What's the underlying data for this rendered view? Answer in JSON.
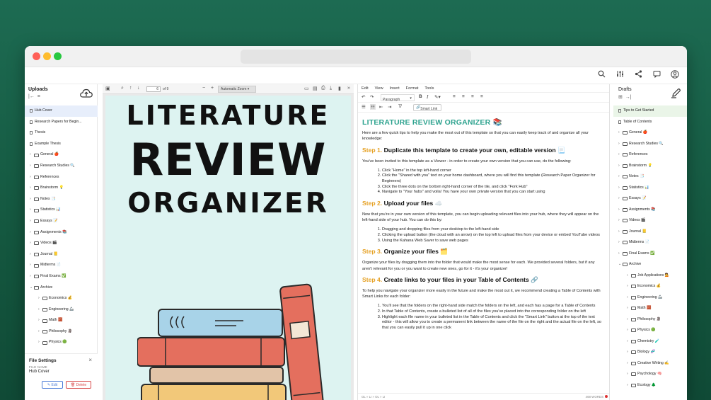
{
  "topbar_icons": [
    "search-icon",
    "sliders-icon",
    "share-icon",
    "comment-icon",
    "user-icon"
  ],
  "left": {
    "title": "Uploads",
    "items": [
      {
        "label": "Hub Cover",
        "type": "file",
        "level": 0,
        "selected": true
      },
      {
        "label": "Research Papers for Begin...",
        "type": "file",
        "level": 0
      },
      {
        "label": "Thesis",
        "type": "file",
        "level": 0
      },
      {
        "label": "Example Thesis",
        "type": "file",
        "level": 0
      },
      {
        "label": "General 🍎",
        "type": "folder",
        "level": 0
      },
      {
        "label": "Research Studies 🔍",
        "type": "folder",
        "level": 0
      },
      {
        "label": "References",
        "type": "folder",
        "level": 0
      },
      {
        "label": "Brainstorm 💡",
        "type": "folder",
        "level": 0
      },
      {
        "label": "Notes 📑",
        "type": "folder",
        "level": 0
      },
      {
        "label": "Statistics 📊",
        "type": "folder",
        "level": 0
      },
      {
        "label": "Essays 📝",
        "type": "folder",
        "level": 0
      },
      {
        "label": "Assignments 📚",
        "type": "folder",
        "level": 0
      },
      {
        "label": "Videos 🎬",
        "type": "folder",
        "level": 0
      },
      {
        "label": "Journal 📒",
        "type": "folder",
        "level": 0
      },
      {
        "label": "Midterms 📄",
        "type": "folder",
        "level": 0
      },
      {
        "label": "Final Exams ✅",
        "type": "folder",
        "level": 0
      },
      {
        "label": "Archive",
        "type": "folder",
        "level": 0,
        "open": true
      },
      {
        "label": "Economics 💰",
        "type": "folder",
        "level": 1
      },
      {
        "label": "Engineering 🦾",
        "type": "folder",
        "level": 1
      },
      {
        "label": "Math 🧱",
        "type": "folder",
        "level": 1
      },
      {
        "label": "Philosophy 🗿",
        "type": "folder",
        "level": 1
      },
      {
        "label": "Physics 🟢",
        "type": "folder",
        "level": 1
      }
    ],
    "file_settings": {
      "title": "File Settings",
      "label": "FILE NAME",
      "name": "Hub Cover",
      "edit": "Edit",
      "delete": "Delete"
    }
  },
  "pdf": {
    "page": "6",
    "of": "of 9",
    "zoom": "Automatic Zoom",
    "cover_line1": "LITERATURE",
    "cover_line2": "REVIEW",
    "cover_line3": "ORGANIZER",
    "colors": {
      "page_bg": "#ddf3f1",
      "book_blue": "#a8d3e8",
      "book_red": "#e46f5e",
      "book_tan": "#e2c4a8",
      "book_yellow": "#f2c879"
    }
  },
  "editor": {
    "menu": [
      "Edit",
      "View",
      "Insert",
      "Format",
      "Tools"
    ],
    "paragraph": "Paragraph",
    "smart_link": "Smart Link",
    "title": "LITERATURE REVIEW ORGANIZER 📚",
    "intro": "Here are a few quick tips to help you make the most out of this template so that you can easily keep track of and organize all your knowledge:",
    "step1": {
      "num": "Step 1.",
      "title": "Duplicate this template to create your own, editable version 📃",
      "p": "You've been invited to this template as a Viewer - in order to create your own version that you can use, do the following:",
      "list": [
        "Click \"Home\" in the top left-hand corner",
        "Click the \"Shared with you\" text on your home dashboard, where you will find this template (Research Paper Organizer for Beginners)",
        "Click the three dots on the bottom right-hand corner of the tile, and click \"Fork Hub\"",
        "Navigate to \"Your hubs\" and voila! You have your own private version that you can start using"
      ]
    },
    "step2": {
      "num": "Step 2.",
      "title": "Upload your files ☁️",
      "p": "Now that you're in your own version of this template, you can begin uploading relevant files into your hub, where they will appear on the left-hand side of your hub. You can do this by:",
      "list": [
        "Dragging and dropping files from your desktop to the left-hand side",
        "Clicking the upload button (the cloud with an arrow) on the top left to upload files from your device or embed YouTube videos",
        "Using the Kahana Web Saver to save web pages"
      ]
    },
    "step3": {
      "num": "Step 3.",
      "title": "Organize your files 🗂️",
      "p": "Organize your files by dragging them into the folder that would make the most sense for each. We provided several folders, but if any aren't relevant for you or you want to create new ones, go for it - it's your organizer!"
    },
    "step4": {
      "num": "Step 4.",
      "title": "Create links to your files in your Table of Contents 🔗",
      "p": "To help you navigate your organizer more easily in the future and make the most out it, we recommend creating a Table of Contents with Smart Links for each folder:",
      "list": [
        "You'll see that the folders on the right-hand side match the folders on the left, and each has a page for a Table of Contents",
        "In that Table of Contents, create a bulleted list of all of the files you've placed into the corresponding folder on the left",
        "Highlight each file name in your bulleted list in the Table of Contents and click the \"Smart Link\" button at the top of the text editor - this will allow you to create a permanent link between the name of the file on the right and the actual file on the left, so that you can easily pull it up in one click"
      ]
    },
    "status_left": "OL » LI » OL » LI",
    "word_count": "468 WORDS",
    "accent_color": "#2ea38f",
    "step_color": "#e6a226"
  },
  "right": {
    "title": "Drafts",
    "items": [
      {
        "label": "Tips to Get Started",
        "type": "file",
        "level": 0,
        "selected": true
      },
      {
        "label": "Table of Contents",
        "type": "file",
        "level": 0
      },
      {
        "label": "General 🍎",
        "type": "folder",
        "level": 0
      },
      {
        "label": "Research Studies 🔍",
        "type": "folder",
        "level": 0
      },
      {
        "label": "References",
        "type": "folder",
        "level": 0
      },
      {
        "label": "Brainstorm 💡",
        "type": "folder",
        "level": 0
      },
      {
        "label": "Notes 📑",
        "type": "folder",
        "level": 0
      },
      {
        "label": "Statistics 📊",
        "type": "folder",
        "level": 0
      },
      {
        "label": "Essays 📝",
        "type": "folder",
        "level": 0
      },
      {
        "label": "Assignments 📚",
        "type": "folder",
        "level": 0
      },
      {
        "label": "Videos 🎬",
        "type": "folder",
        "level": 0
      },
      {
        "label": "Journal 📒",
        "type": "folder",
        "level": 0
      },
      {
        "label": "Midterms 📄",
        "type": "folder",
        "level": 0
      },
      {
        "label": "Final Exams ✅",
        "type": "folder",
        "level": 0
      },
      {
        "label": "Archive",
        "type": "folder",
        "level": 0,
        "open": true
      },
      {
        "label": "Job Applications 💁",
        "type": "folder",
        "level": 1
      },
      {
        "label": "Economics 💰",
        "type": "folder",
        "level": 1
      },
      {
        "label": "Engineering 🦾",
        "type": "folder",
        "level": 1
      },
      {
        "label": "Math 🧱",
        "type": "folder",
        "level": 1
      },
      {
        "label": "Philosophy 🗿",
        "type": "folder",
        "level": 1
      },
      {
        "label": "Physics 🟢",
        "type": "folder",
        "level": 1
      },
      {
        "label": "Chemistry 🧪",
        "type": "folder",
        "level": 1
      },
      {
        "label": "Biology 🧬",
        "type": "folder",
        "level": 1
      },
      {
        "label": "Creative Writing ✍️",
        "type": "folder",
        "level": 1
      },
      {
        "label": "Psychology 🧠",
        "type": "folder",
        "level": 1
      },
      {
        "label": "Ecology 🌲",
        "type": "folder",
        "level": 1
      }
    ]
  }
}
